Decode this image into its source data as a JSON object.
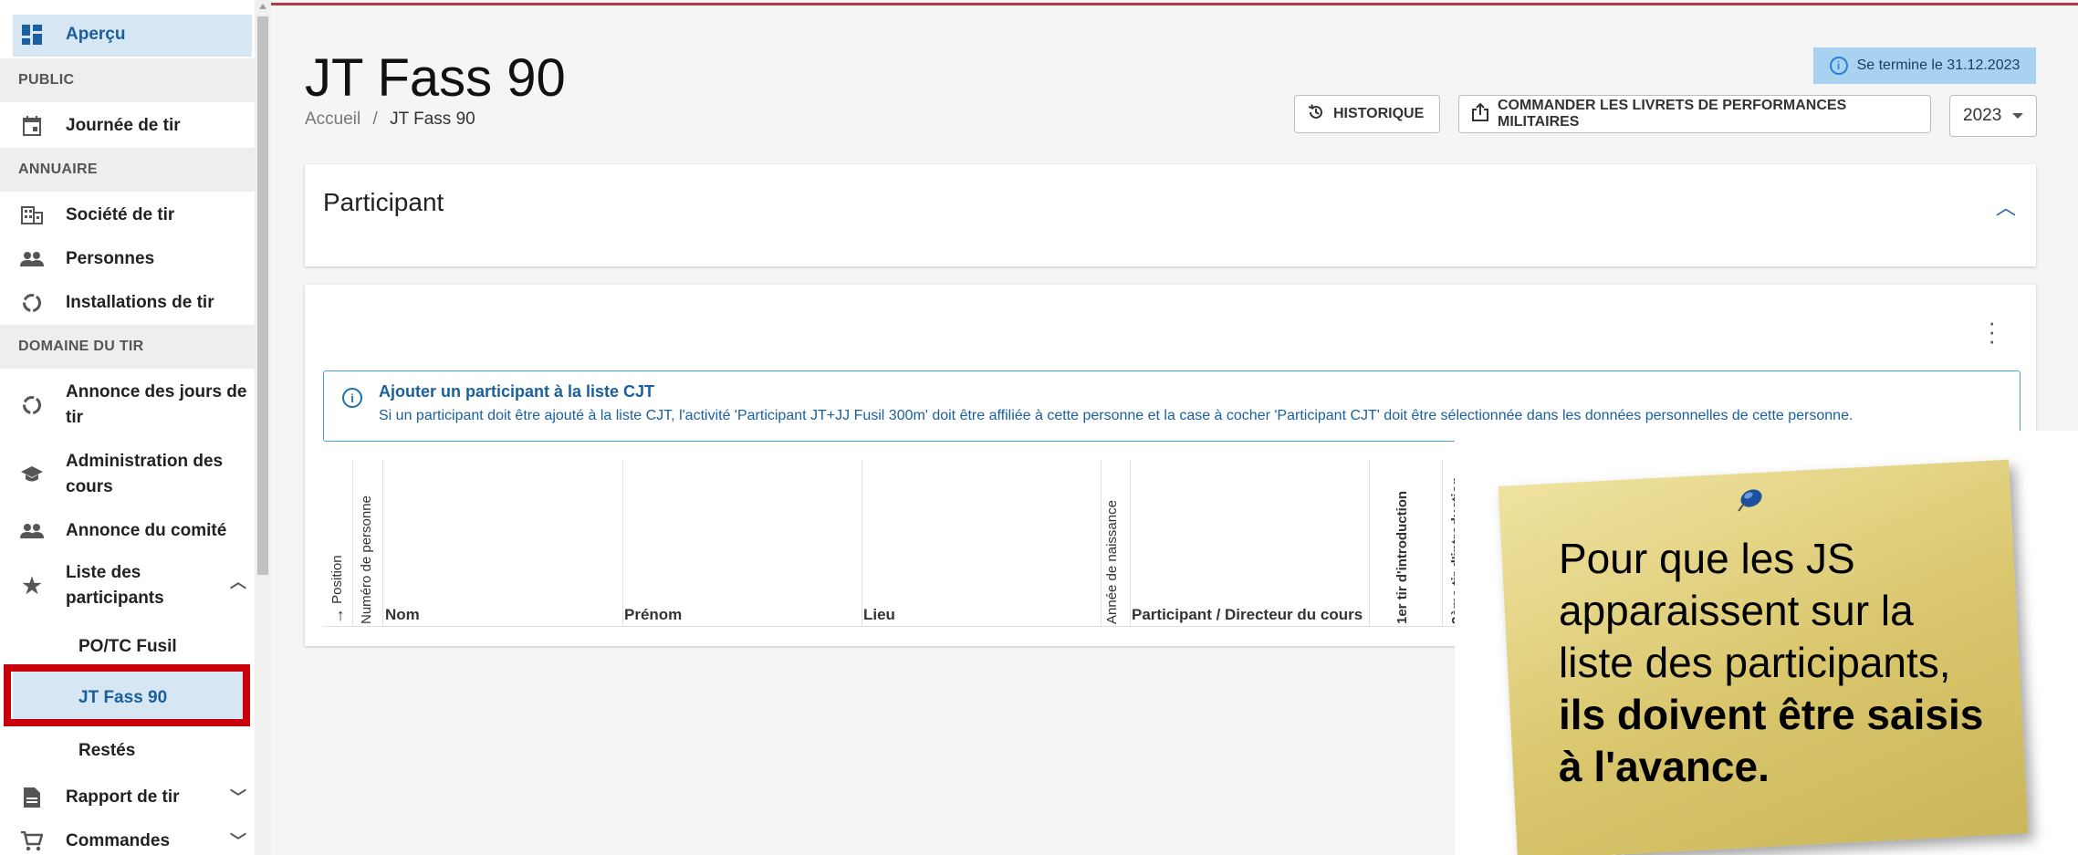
{
  "sidebar": {
    "apercu": "Aperçu",
    "section_public": "PUBLIC",
    "journee": "Journée de tir",
    "section_annuaire": "ANNUAIRE",
    "societe": "Société de tir",
    "personnes": "Personnes",
    "installations": "Installations de tir",
    "section_domaine": "DOMAINE DU TIR",
    "annonce_jours_1": "Annonce des jours de",
    "annonce_jours_2": "tir",
    "admin_cours_1": "Administration des",
    "admin_cours_2": "cours",
    "annonce_comite": "Annonce du comité",
    "liste_1": "Liste des",
    "liste_2": "participants",
    "sub_po": "PO/TC Fusil",
    "sub_jt": "JT Fass 90",
    "sub_restes": "Restés",
    "rapport": "Rapport de tir",
    "commandes": "Commandes"
  },
  "header": {
    "title": "JT Fass 90",
    "breadcrumb_home": "Accueil",
    "breadcrumb_sep": "/",
    "breadcrumb_current": "JT Fass 90",
    "end_badge": "Se termine le 31.12.2023",
    "historique": "HISTORIQUE",
    "commander": "COMMANDER LES LIVRETS DE PERFORMANCES MILITAIRES",
    "year": "2023"
  },
  "participant_card": {
    "title": "Participant"
  },
  "info": {
    "heading": "Ajouter un participant à la liste CJT",
    "text": "Si un participant doit être ajouté à la liste CJT, l'activité 'Participant JT+JJ Fusil 300m' doit être affiliée à cette personne et la case à cocher 'Participant CJT' doit être sélectionnée dans les données personnelles de cette personne."
  },
  "table": {
    "col_position": "Position",
    "col_numero": "Numéro de personne",
    "col_nom": "Nom",
    "col_prenom": "Prénom",
    "col_lieu": "Lieu",
    "col_annee": "Année de naissance",
    "col_participant": "Participant / Directeur du cours",
    "col_1er": "1er tir d'introduction",
    "col_2eme": "2ème tir d'introduction"
  },
  "note": {
    "line_plain": "Pour que les JS apparaissent sur la liste des participants,",
    "line_bold": "ils doivent être saisis à l'avance."
  },
  "colors": {
    "accent": "#1a5f9e",
    "highlight": "#c8000a",
    "badge": "#a9d2f1"
  }
}
